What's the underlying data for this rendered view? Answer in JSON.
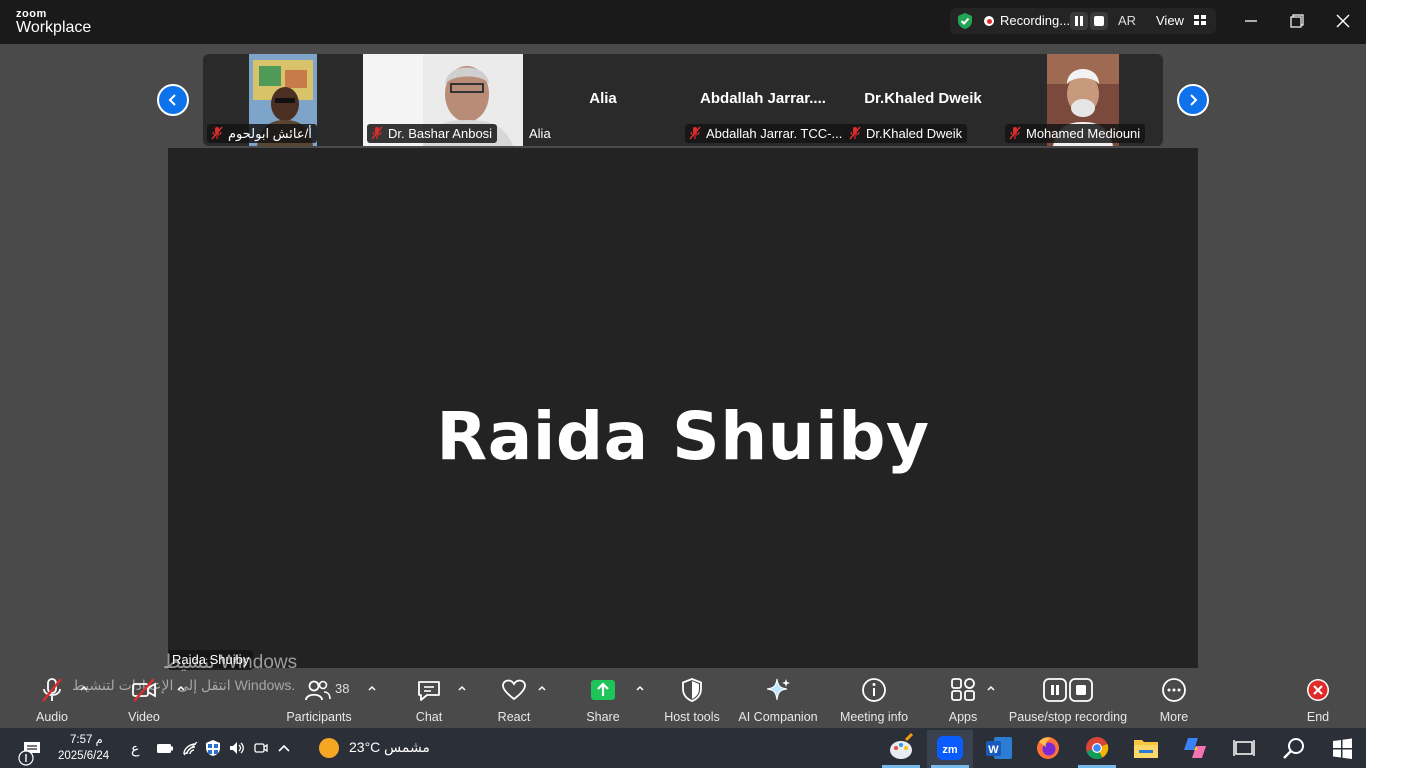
{
  "window": {
    "logo_top": "zoom",
    "logo_main": "Workplace",
    "recording_label": "Recording...",
    "language": "AR",
    "view_label": "View"
  },
  "gallery": {
    "tiles": [
      {
        "name": "أ/عائش ابولحوم",
        "has_video": true,
        "muted": true
      },
      {
        "name": "Dr. Bashar Anbosi",
        "has_video": true,
        "muted": true
      },
      {
        "name": "Alia",
        "display_name": "Alia",
        "has_video": false,
        "muted": false
      },
      {
        "name": "Abdallah Jarrar. TCC-...",
        "display_name": "Abdallah  Jarrar....",
        "has_video": false,
        "muted": true
      },
      {
        "name": "Dr.Khaled Dweik",
        "display_name": "Dr.Khaled Dweik",
        "has_video": false,
        "muted": true
      },
      {
        "name": "Mohamed Mediouni",
        "has_video": true,
        "muted": true
      }
    ]
  },
  "main": {
    "speaker_display": "Raida Shuiby",
    "speaker_tag": "Raida Shuiby"
  },
  "watermark": {
    "line1": "تنشيط Windows",
    "line2": "انتقل إلى الإعدادات لتنشيط Windows."
  },
  "toolbar": {
    "audio": "Audio",
    "video": "Video",
    "participants": "Participants",
    "participants_count": "38",
    "chat": "Chat",
    "react": "React",
    "share": "Share",
    "host_tools": "Host tools",
    "ai_companion": "AI Companion",
    "meeting_info": "Meeting info",
    "apps": "Apps",
    "pause_stop": "Pause/stop recording",
    "more": "More",
    "end": "End"
  },
  "taskbar": {
    "time": "7:57 م",
    "date": "2025/6/24",
    "lang": "ع",
    "temperature": "23°C",
    "weather": "مشمس"
  },
  "colors": {
    "accent_blue": "#0e72ed",
    "share_green": "#1fc45a",
    "end_red": "#e02b2b",
    "mute_red": "#e02b2b"
  }
}
